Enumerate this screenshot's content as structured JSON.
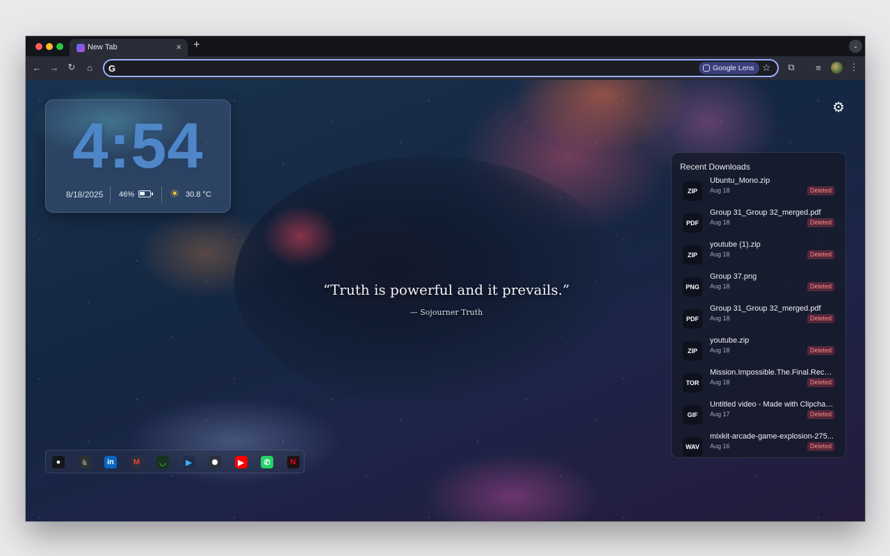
{
  "browser": {
    "tab_title": "New Tab",
    "tab_close": "×",
    "new_tab": "+",
    "omnibox_icon": "G",
    "lens_label": "Google Lens"
  },
  "clock": {
    "time": "4:54",
    "date": "8/18/2025",
    "battery": "46%",
    "battery_level": 0.46,
    "temperature": "30.8 °C"
  },
  "quote": {
    "text": "“Truth is powerful and it prevails.”",
    "author": "— Sojourner Truth"
  },
  "downloads": {
    "title": "Recent Downloads",
    "items": [
      {
        "type": "ZIP",
        "name": "Ubuntu_Mono.zip",
        "date": "Aug 18",
        "status": "Deleted"
      },
      {
        "type": "PDF",
        "name": "Group 31_Group 32_merged.pdf",
        "date": "Aug 18",
        "status": "Deleted"
      },
      {
        "type": "ZIP",
        "name": "youtube (1).zip",
        "date": "Aug 18",
        "status": "Deleted"
      },
      {
        "type": "PNG",
        "name": "Group 37.png",
        "date": "Aug 18",
        "status": "Deleted"
      },
      {
        "type": "PDF",
        "name": "Group 31_Group 32_merged.pdf",
        "date": "Aug 18",
        "status": "Deleted"
      },
      {
        "type": "ZIP",
        "name": "youtube.zip",
        "date": "Aug 18",
        "status": "Deleted"
      },
      {
        "type": "TOR",
        "name": "Mission.Impossible.The.Final.Reckon...",
        "date": "Aug 18",
        "status": "Deleted"
      },
      {
        "type": "GIF",
        "name": "Untitled video - Made with Clipcham...",
        "date": "Aug 17",
        "status": "Deleted"
      },
      {
        "type": "WAV",
        "name": "mixkit-arcade-game-explosion-275...",
        "date": "Aug 16",
        "status": "Deleted"
      }
    ]
  },
  "shortcuts": [
    {
      "icon": "github-icon",
      "color": "#ffffff",
      "bg": "#14161d"
    },
    {
      "icon": "godzilla-icon",
      "color": "#6f7a73",
      "bg": "#2b3130"
    },
    {
      "icon": "linkedin-icon",
      "color": "#ffffff",
      "bg": "#0a66c2"
    },
    {
      "icon": "gmail-icon",
      "color": "#ea4335",
      "bg": "#2a2f3c"
    },
    {
      "icon": "tradingview-icon",
      "color": "#2fa34a",
      "bg": "#16331f"
    },
    {
      "icon": "google-play-icon",
      "color": "#3bb0f7",
      "bg": "#1d2f4a"
    },
    {
      "icon": "chatgpt-icon",
      "color": "#ffffff",
      "bg": "#2a2f3c"
    },
    {
      "icon": "youtube-icon",
      "color": "#ffffff",
      "bg": "#ff0000"
    },
    {
      "icon": "whatsapp-icon",
      "color": "#ffffff",
      "bg": "#25d366"
    },
    {
      "icon": "netflix-icon",
      "color": "#e50914",
      "bg": "#1e1015"
    }
  ],
  "colors": {
    "clock": "#4f86c8",
    "accent": "#9bb2ff",
    "deleted": "#ff8a8a"
  }
}
